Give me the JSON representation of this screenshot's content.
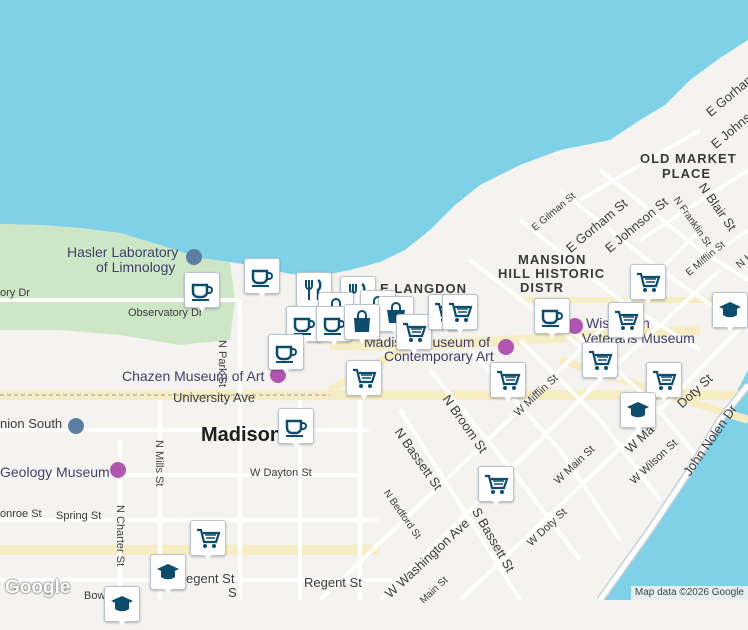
{
  "colors": {
    "water": "#7fd1e8",
    "land": "#f4f3ef",
    "park": "#cde7c6",
    "road": "#ffffff",
    "highlight": "#f7edc4",
    "pin": "#0d4c6c"
  },
  "labels": {
    "hasler": "Hasler Laboratory",
    "hasler2": "of Limnology",
    "observatory_dr": "ory Dr",
    "observatory_dr2": "Observatory Dr",
    "n_park_st": "N Park St",
    "chazen": "Chazen Museum of Art",
    "university_ave": "University Ave",
    "union_south": "nion South",
    "madison": "Madison",
    "n_mills_st": "N Mills St",
    "geology": "Geology Museum",
    "w_dayton_st": "W Dayton St",
    "monroe_st": "onroe St",
    "spring_st": "Spring St",
    "n_charter_st": "N Charter St",
    "regent_st": "Regent St",
    "regent_st2": "egent St",
    "bow": "Bow",
    "e_langdon": "E LANGDON",
    "madison_mca": "Madison Museum of",
    "contemporary": "Contemporary Art",
    "n_broom_st": "N Broom St",
    "n_bassett_st": "N Bassett St",
    "n_bedford_st": "N Bedford St",
    "w_washington": "W Washington Ave",
    "s_bassett": "S Bassett St",
    "w_doty_st": "W Doty St",
    "w_mifflin_st": "W Mifflin St",
    "w_main_st": "W Main St",
    "w_wilson_st": "W Wilson St",
    "john_nolen": "John Nolen Dr",
    "mansion_hill": "MANSION",
    "mansion_hill2": "HILL HISTORIC",
    "mansion_hill3": "DISTR",
    "old_market": "OLD MARKET",
    "old_market2": "PLACE",
    "e_gilman": "E Gilman St",
    "e_gorham": "E Gorham St",
    "e_johnson": "E Johnson St",
    "n_blair": "N Blair St",
    "n_franklin": "N Franklin St",
    "e_mifflin": "E Mifflin St",
    "e_gorham2": "E Gorham St",
    "e_johnson2": "E Johnson St",
    "wisconsin_vet": "Wisconsin",
    "wisconsin_vet2": "Veterans Museum",
    "doty": "Doty St",
    "n_h": "N H",
    "w_ma": "W Ma",
    "main_st_bottom": "Main St",
    "n_carroll": "S"
  },
  "pins": [
    {
      "icon": "coffee"
    },
    {
      "icon": "coffee"
    },
    {
      "icon": "restaurant"
    },
    {
      "icon": "restaurant"
    },
    {
      "icon": "shop"
    },
    {
      "icon": "shop"
    },
    {
      "icon": "shop"
    },
    {
      "icon": "coffee"
    },
    {
      "icon": "coffee"
    },
    {
      "icon": "bag"
    },
    {
      "icon": "cart"
    },
    {
      "icon": "cart"
    },
    {
      "icon": "cart"
    },
    {
      "icon": "coffee"
    },
    {
      "icon": "coffee"
    },
    {
      "icon": "cart"
    },
    {
      "icon": "cart"
    },
    {
      "icon": "cart"
    },
    {
      "icon": "school"
    },
    {
      "icon": "cart"
    },
    {
      "icon": "cart"
    },
    {
      "icon": "cart"
    },
    {
      "icon": "school"
    },
    {
      "icon": "cart"
    },
    {
      "icon": "coffee"
    },
    {
      "icon": "cart"
    },
    {
      "icon": "school"
    },
    {
      "icon": "school"
    }
  ],
  "footer": {
    "logo": "Google",
    "attribution": "Map data ©2026 Google"
  }
}
